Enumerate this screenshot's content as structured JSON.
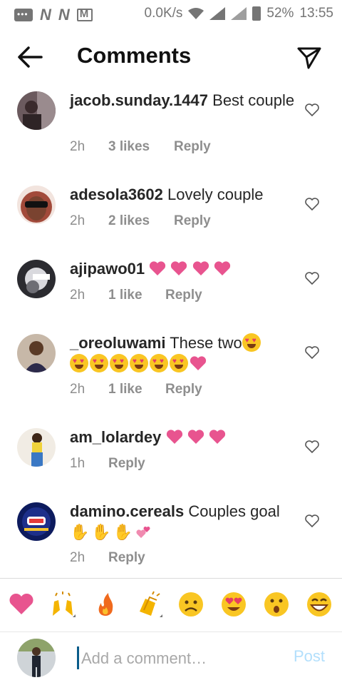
{
  "status_bar": {
    "speed": "0.0K/s",
    "battery": "52%",
    "time": "13:55"
  },
  "header": {
    "title": "Comments"
  },
  "comments": [
    {
      "username": "jacob.sunday.1447",
      "text": "Best couple",
      "time": "2h",
      "likes": "3 likes",
      "reply": "Reply"
    },
    {
      "username": "adesola3602",
      "text": "Lovely couple",
      "time": "2h",
      "likes": "2 likes",
      "reply": "Reply"
    },
    {
      "username": "ajipawo01",
      "text": "",
      "time": "2h",
      "likes": "1 like",
      "reply": "Reply"
    },
    {
      "username": "_oreoluwami",
      "text": "These two",
      "time": "2h",
      "likes": "1 like",
      "reply": "Reply"
    },
    {
      "username": "am_lolardey",
      "text": "",
      "time": "1h",
      "likes": "",
      "reply": "Reply"
    },
    {
      "username": "damino.cereals",
      "text": "Couples goal",
      "time": "2h",
      "likes": "",
      "reply": "Reply"
    }
  ],
  "emoji_bar": [
    "pink-heart",
    "raised-hands",
    "fire",
    "clapping-hands",
    "sad-face",
    "heart-eyes-face",
    "surprised-face",
    "grinning-face"
  ],
  "composer": {
    "placeholder": "Add a comment…",
    "post_label": "Post"
  },
  "colors": {
    "heart_pink": "#e8548f",
    "post_disabled": "#b2dffc",
    "meta_gray": "#8e8e8e"
  }
}
